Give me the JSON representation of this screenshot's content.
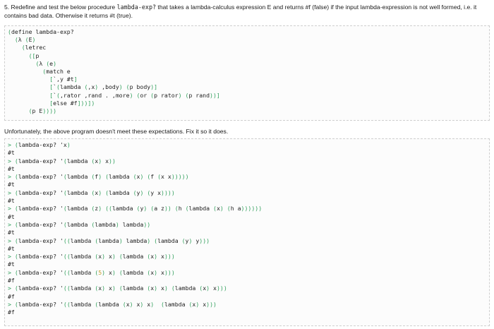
{
  "prompt": {
    "before": "5. Redefine and test the below procedure ",
    "code": "lambda-exp?",
    "after": " that takes a lambda-calculus expression E and returns #f (false) if the input lambda-expression is not well formed, i.e. it contains bad data. Otherwise it returns #t (true)."
  },
  "definition_lines": [
    "(define lambda-exp?",
    "  (λ (E)",
    "    (letrec",
    "      ([p",
    "        (λ (e)",
    "          (match e",
    "            [`,y #t]",
    "            [`(lambda (,x) ,body) (p body)]",
    "            [`(,rator ,rand . ,more) (or (p rator) (p rand))]",
    "            [else #f]))])",
    "      (p E))))"
  ],
  "instruction": "Unfortunately, the above program doesn't meet these expectations. Fix it so it does.",
  "repl": [
    {
      "input": "> (lambda-exp? 'x)",
      "output": "#t"
    },
    {
      "input": "> (lambda-exp? '(lambda (x) x))",
      "output": "#t"
    },
    {
      "input": "> (lambda-exp? '(lambda (f) (lambda (x) (f (x x)))))",
      "output": "#t"
    },
    {
      "input": "> (lambda-exp? '(lambda (x) (lambda (y) (y x))))",
      "output": "#t"
    },
    {
      "input": "> (lambda-exp? '(lambda (z) ((lambda (y) (a z)) (h (lambda (x) (h a))))))",
      "output": "#t"
    },
    {
      "input": "> (lambda-exp? '(lambda (lambda) lambda))",
      "output": "#t"
    },
    {
      "input": "> (lambda-exp? '((lambda (lambda) lambda) (lambda (y) y)))",
      "output": "#t"
    },
    {
      "input": "> (lambda-exp? '((lambda (x) x) (lambda (x) x)))",
      "output": "#t"
    },
    {
      "input": "> (lambda-exp? '((lambda (5) x) (lambda (x) x)))",
      "output": "#f"
    },
    {
      "input": "> (lambda-exp? '((lambda (x) x) (lambda (x) x) (lambda (x) x)))",
      "output": "#f"
    },
    {
      "input": "> (lambda-exp? '((lambda (lambda (x) x) x)  (lambda (x) x)))",
      "output": "#f"
    }
  ],
  "colors": {
    "paren": "#2f9e5a",
    "number": "#c49a2c",
    "text": "#1a1a1a"
  }
}
